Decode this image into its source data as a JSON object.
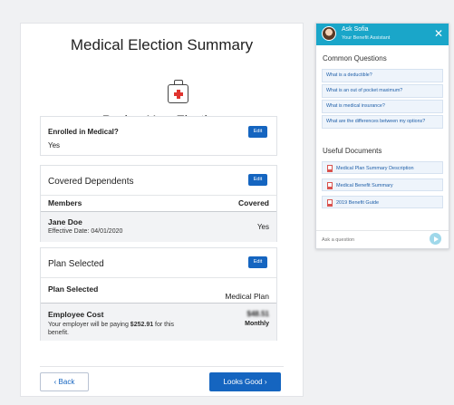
{
  "main": {
    "title": "Medical Election Summary",
    "subtitle": "Review Your Election",
    "icon": "medical-kit-icon",
    "enrolled": {
      "question": "Enrolled in Medical?",
      "answer": "Yes",
      "edit_label": "Edit"
    },
    "dependents": {
      "heading": "Covered Dependents",
      "edit_label": "Edit",
      "col_members": "Members",
      "col_covered": "Covered",
      "rows": [
        {
          "name": "Jane Doe",
          "effective": "Effective Date: 04/01/2020",
          "covered": "Yes"
        }
      ]
    },
    "plan": {
      "heading": "Plan Selected",
      "edit_label": "Edit",
      "label": "Plan Selected",
      "value": "Medical Plan",
      "cost_label": "Employee Cost",
      "cost_note_prefix": "Your employer will be paying ",
      "employer_amount": "$252.91",
      "cost_note_suffix": " for this benefit.",
      "cost_amount": "$48.51",
      "cost_frequency": "Monthly"
    },
    "back_label": "Back",
    "next_label": "Looks Good"
  },
  "assistant": {
    "name": "Ask Sofia",
    "subtitle": "Your Benefit Assistant",
    "close_icon": "close-icon",
    "questions_heading": "Common Questions",
    "questions": [
      "What is a deductible?",
      "What is an out of pocket maximum?",
      "What is medical insurance?",
      "What are the differences between my options?"
    ],
    "docs_heading": "Useful Documents",
    "documents": [
      "Medical Plan Summary Description",
      "Medical Benefit Summary",
      "2019 Benefit Guide"
    ],
    "ask_placeholder": "Ask a question"
  },
  "colors": {
    "primary": "#1565c0",
    "assistant_header": "#1aa6c9",
    "page_bg": "#f0f1f3"
  }
}
